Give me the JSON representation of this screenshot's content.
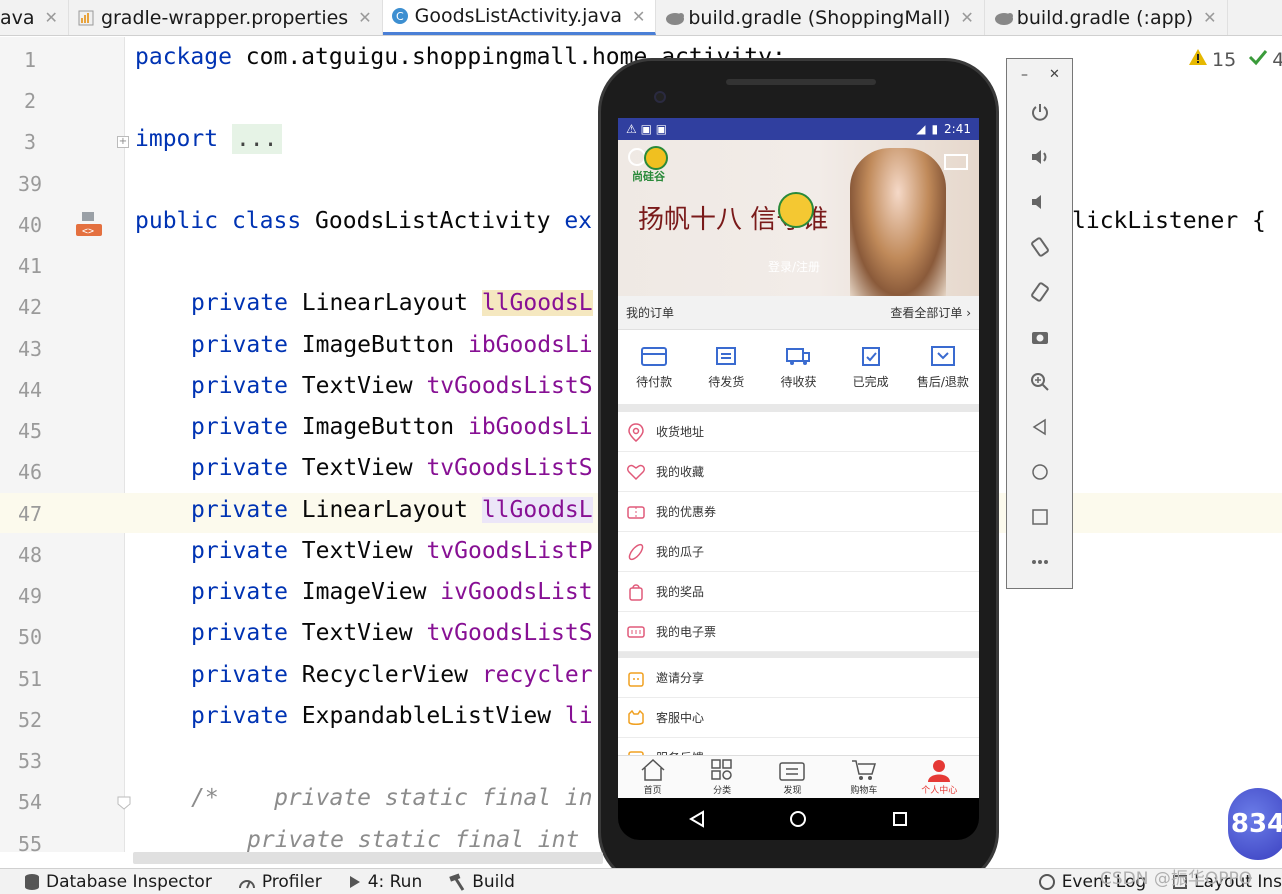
{
  "tabs": [
    {
      "label": "ava",
      "active": false
    },
    {
      "label": "gradle-wrapper.properties",
      "active": false
    },
    {
      "label": "GoodsListActivity.java",
      "active": true
    },
    {
      "label": "build.gradle (ShoppingMall)",
      "active": false
    },
    {
      "label": "build.gradle (:app)",
      "active": false
    }
  ],
  "editor": {
    "line_numbers": [
      "1",
      "2",
      "3",
      "39",
      "40",
      "41",
      "42",
      "43",
      "44",
      "45",
      "46",
      "47",
      "48",
      "49",
      "50",
      "51",
      "52",
      "53",
      "54",
      "55"
    ],
    "line1_kw": "package",
    "line1_text": " com.atguigu.shoppingmall.home.activity;",
    "line3_kw": "import",
    "line3_fold": "...",
    "line40_kw1": "public",
    "line40_kw2": "class",
    "line40_name": " GoodsListActivity ",
    "line40_kw3": "ex",
    "line40_tail": "lickListener {",
    "fields": [
      {
        "type": "LinearLayout",
        "name": "llGoodsL"
      },
      {
        "type": "ImageButton",
        "name": "ibGoodsLi"
      },
      {
        "type": "TextView",
        "name": "tvGoodsListS"
      },
      {
        "type": "ImageButton",
        "name": "ibGoodsLi"
      },
      {
        "type": "TextView",
        "name": "tvGoodsListS"
      },
      {
        "type": "LinearLayout",
        "name": "llGoodsL"
      },
      {
        "type": "TextView",
        "name": "tvGoodsListP"
      },
      {
        "type": "ImageView",
        "name": "ivGoodsList"
      },
      {
        "type": "TextView",
        "name": "tvGoodsListS"
      },
      {
        "type": "RecyclerView",
        "name": "recycler"
      },
      {
        "type": "ExpandableListView",
        "name": "li"
      }
    ],
    "private_kw": "private",
    "comment54": "/*    private static final in",
    "comment55": "private static final int"
  },
  "inspections": {
    "warnings": "15",
    "ok": "4"
  },
  "statusbar": {
    "database_inspector": "Database Inspector",
    "profiler": "Profiler",
    "run": "4: Run",
    "build": "Build",
    "event_log": "Event Log",
    "layout_inspector": "Layout Ins"
  },
  "phone": {
    "time": "2:41",
    "orders_title": "我的订单",
    "orders_all": "查看全部订单",
    "order_items": [
      "待付款",
      "待发货",
      "待收获",
      "已完成",
      "售后/退款"
    ],
    "menu_group1": [
      "收货地址",
      "我的收藏",
      "我的优惠券",
      "我的瓜子",
      "我的奖品",
      "我的电子票"
    ],
    "menu_group2": [
      "邀请分享",
      "客服中心",
      "服务反馈"
    ],
    "bottom_tabs": [
      "首页",
      "分类",
      "发现",
      "购物车",
      "个人中心"
    ],
    "brand": "尚硅谷",
    "login_text": "登录/注册",
    "banner_calligraphy": "扬帆十八 信守谁"
  },
  "emulator_toolbar": {
    "buttons": [
      "power-icon",
      "volume-up-icon",
      "volume-down-icon",
      "rotate-left-icon",
      "rotate-right-icon",
      "camera-icon",
      "zoom-icon",
      "back-icon",
      "home-icon",
      "overview-icon",
      "more-icon"
    ]
  },
  "overlay": {
    "badge_text": "834",
    "watermark": "CSDN @振华OPPO"
  },
  "colors": {
    "keyword": "#0033b3",
    "field": "#871094",
    "android_status": "#303f9f",
    "active_tab_red": "#e53935"
  }
}
